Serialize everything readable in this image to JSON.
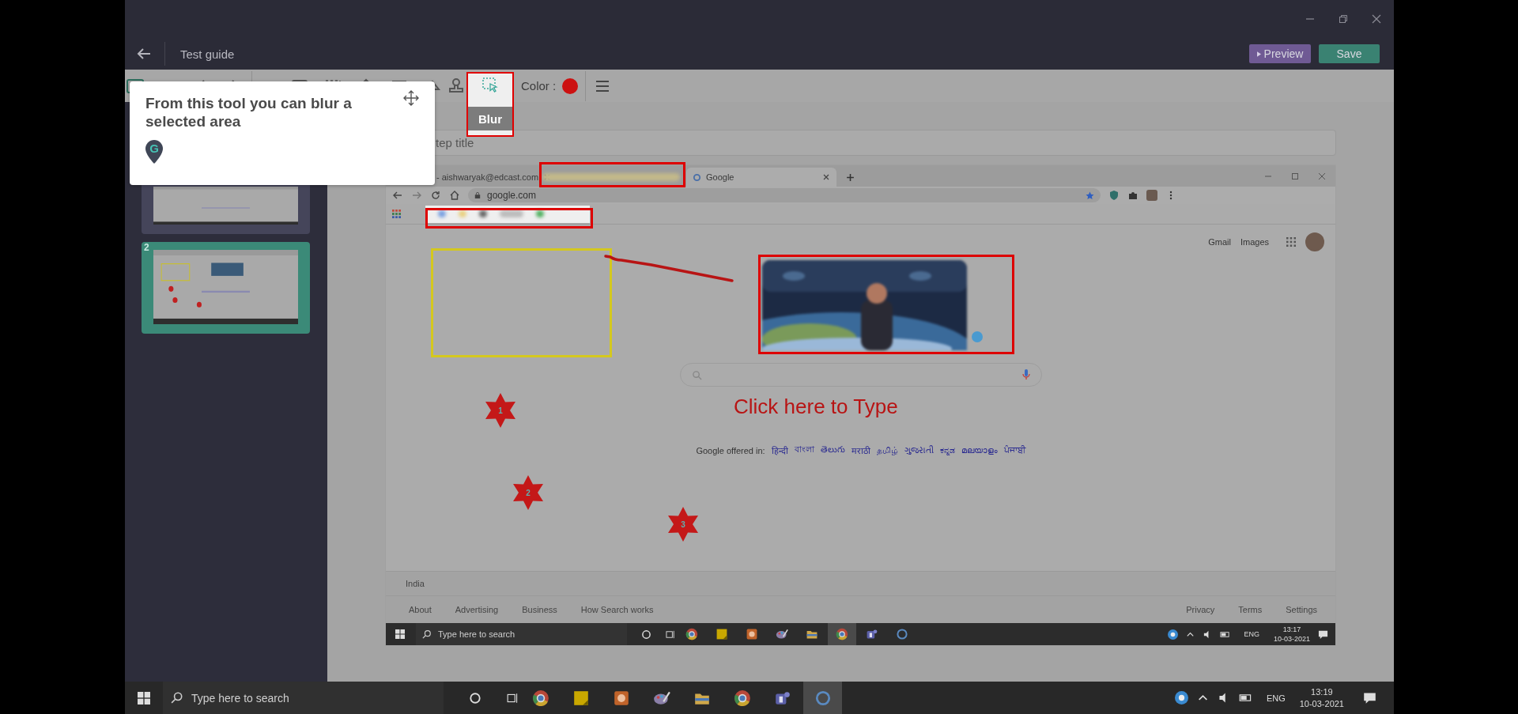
{
  "header": {
    "title": "Test guide",
    "buttons": [
      {
        "kind": "preview",
        "label": "Preview"
      },
      {
        "kind": "save",
        "label": "Save"
      }
    ]
  },
  "toolbar": {
    "color_label": "Color :",
    "color": "#cc1111",
    "highlighted_tool": {
      "tooltip": "Blur"
    }
  },
  "tour_tip": {
    "text": "From this tool you can blur a selected area",
    "logo_letter": "G"
  },
  "sidebar": {
    "slides": [
      {
        "selected": false
      },
      {
        "number": "2",
        "selected": true
      }
    ]
  },
  "step_title": {
    "placeholder": "tep title"
  },
  "screenshot": {
    "tabs": [
      {
        "label": "- aishwaryak@edcast.com",
        "blurred": false,
        "selected": false
      },
      {
        "blurred": true,
        "selected": false
      },
      {
        "label": "Google",
        "blurred": false,
        "selected": true
      }
    ],
    "address": "google.com",
    "page": {
      "links": [
        "Gmail",
        "Images"
      ],
      "offered_label": "Google offered in:",
      "languages": [
        "हिन्दी",
        "বাংলা",
        "తెలుగు",
        "मराठी",
        "தமிழ்",
        "ગુજરાતી",
        "ಕನ್ನಡ",
        "മലയാളം",
        "ਪੰਜਾਬੀ"
      ],
      "country": "India",
      "footer_left": [
        "About",
        "Advertising",
        "Business",
        "How Search works"
      ],
      "footer_right": [
        "Privacy",
        "Terms",
        "Settings"
      ]
    },
    "taskbar": {
      "search_placeholder": "Type here to search",
      "language": "ENG",
      "time": "13:17",
      "date": "10-03-2021",
      "apps": [
        {
          "kind": "browser",
          "selected": false
        },
        {
          "kind": "notes",
          "selected": false
        },
        {
          "kind": "media",
          "selected": false
        },
        {
          "kind": "paint",
          "selected": false
        },
        {
          "kind": "folder",
          "selected": false
        },
        {
          "kind": "browser",
          "selected": true
        },
        {
          "kind": "teams",
          "selected": false
        },
        {
          "kind": "guide",
          "selected": false
        }
      ]
    },
    "annotations": [
      {
        "kind": "rect",
        "color": "#dd0000"
      },
      {
        "kind": "rect",
        "color": "#dd0000"
      },
      {
        "kind": "rect",
        "color": "#d4c81e"
      },
      {
        "kind": "rect",
        "color": "#dd0000"
      },
      {
        "kind": "line",
        "color": "#b81414"
      },
      {
        "kind": "star",
        "label": "1"
      },
      {
        "kind": "star",
        "label": "2"
      },
      {
        "kind": "star",
        "label": "3"
      },
      {
        "kind": "text",
        "text": "Click here to Type"
      }
    ]
  },
  "taskbar": {
    "search_placeholder": "Type here to search",
    "language": "ENG",
    "time": "13:19",
    "date": "10-03-2021",
    "apps": [
      {
        "kind": "browser",
        "selected": false
      },
      {
        "kind": "notes",
        "selected": false
      },
      {
        "kind": "media",
        "selected": false
      },
      {
        "kind": "paint",
        "selected": false
      },
      {
        "kind": "folder",
        "selected": false
      },
      {
        "kind": "browser",
        "selected": false
      },
      {
        "kind": "teams",
        "selected": false
      },
      {
        "kind": "guide",
        "selected": true
      }
    ]
  }
}
